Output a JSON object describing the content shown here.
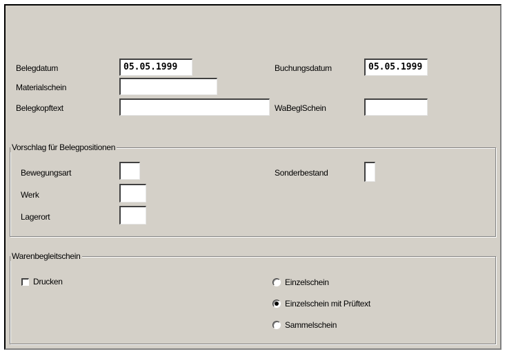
{
  "header": {
    "belegdatum_label": "Belegdatum",
    "belegdatum_value": "05.05.1999",
    "buchungsdatum_label": "Buchungsdatum",
    "buchungsdatum_value": "05.05.1999",
    "materialschein_label": "Materialschein",
    "materialschein_value": "",
    "belegkopftext_label": "Belegkopftext",
    "belegkopftext_value": "",
    "wabeglschein_label": "WaBeglSchein",
    "wabeglschein_value": ""
  },
  "vorschlag": {
    "title": "Vorschlag für Belegpositionen",
    "bewegungsart_label": "Bewegungsart",
    "bewegungsart_value": "",
    "werk_label": "Werk",
    "werk_value": "",
    "lagerort_label": "Lagerort",
    "lagerort_value": "",
    "sonderbestand_label": "Sonderbestand",
    "sonderbestand_value": ""
  },
  "warenbegleitschein": {
    "title": "Warenbegleitschein",
    "drucken_label": "Drucken",
    "drucken_checked": false,
    "options": [
      {
        "label": "Einzelschein",
        "selected": false
      },
      {
        "label": "Einzelschein mit Prüftext",
        "selected": true
      },
      {
        "label": "Sammelschein",
        "selected": false
      }
    ]
  },
  "colors": {
    "panel": "#d4d0c8",
    "field": "#ffffff",
    "shadow": "#808080"
  }
}
